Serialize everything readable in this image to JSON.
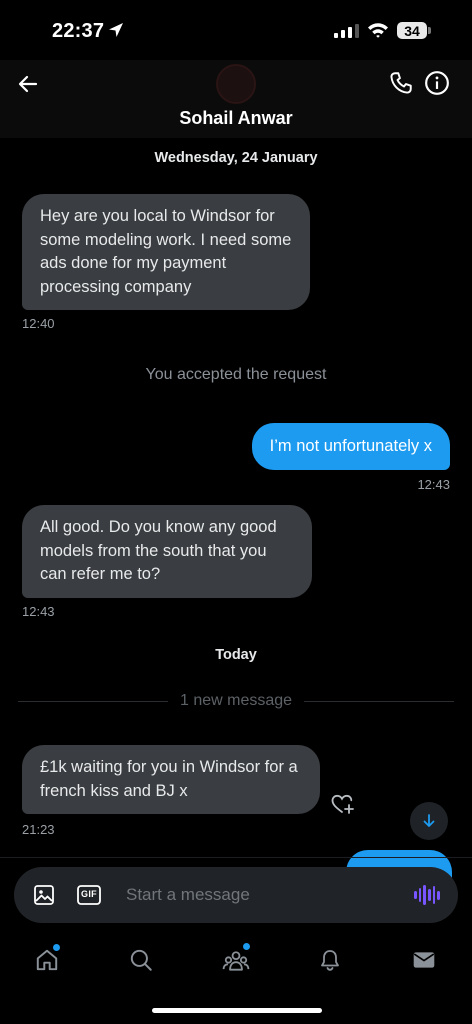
{
  "status_bar": {
    "time": "22:37",
    "battery": "34"
  },
  "header": {
    "contact_name": "Sohail Anwar"
  },
  "chat": {
    "date_1": "Wednesday, 24 January",
    "msg1": {
      "text": "Hey are you local to Windsor for some modeling work. I need some ads done for my payment processing company",
      "time": "12:40"
    },
    "system_note": "You accepted the request",
    "msg2": {
      "text": "I’m not unfortunately x",
      "time": "12:43"
    },
    "msg3": {
      "text": "All good. Do you know any good models from the south that you can refer me to?",
      "time": "12:43"
    },
    "date_2": "Today",
    "new_messages": "1 new message",
    "msg4": {
      "text": "£1k waiting for you in Windsor for a french kiss and BJ x",
      "time": "21:23"
    }
  },
  "composer": {
    "placeholder": "Start a message",
    "gif_label": "GIF"
  },
  "tabs": [
    "home-icon",
    "search-icon",
    "communities-icon",
    "notifications-icon",
    "messages-icon"
  ],
  "colors": {
    "accent": "#1d9bf0",
    "incoming_bubble": "#3a3d41",
    "voice": "#7856ff"
  }
}
